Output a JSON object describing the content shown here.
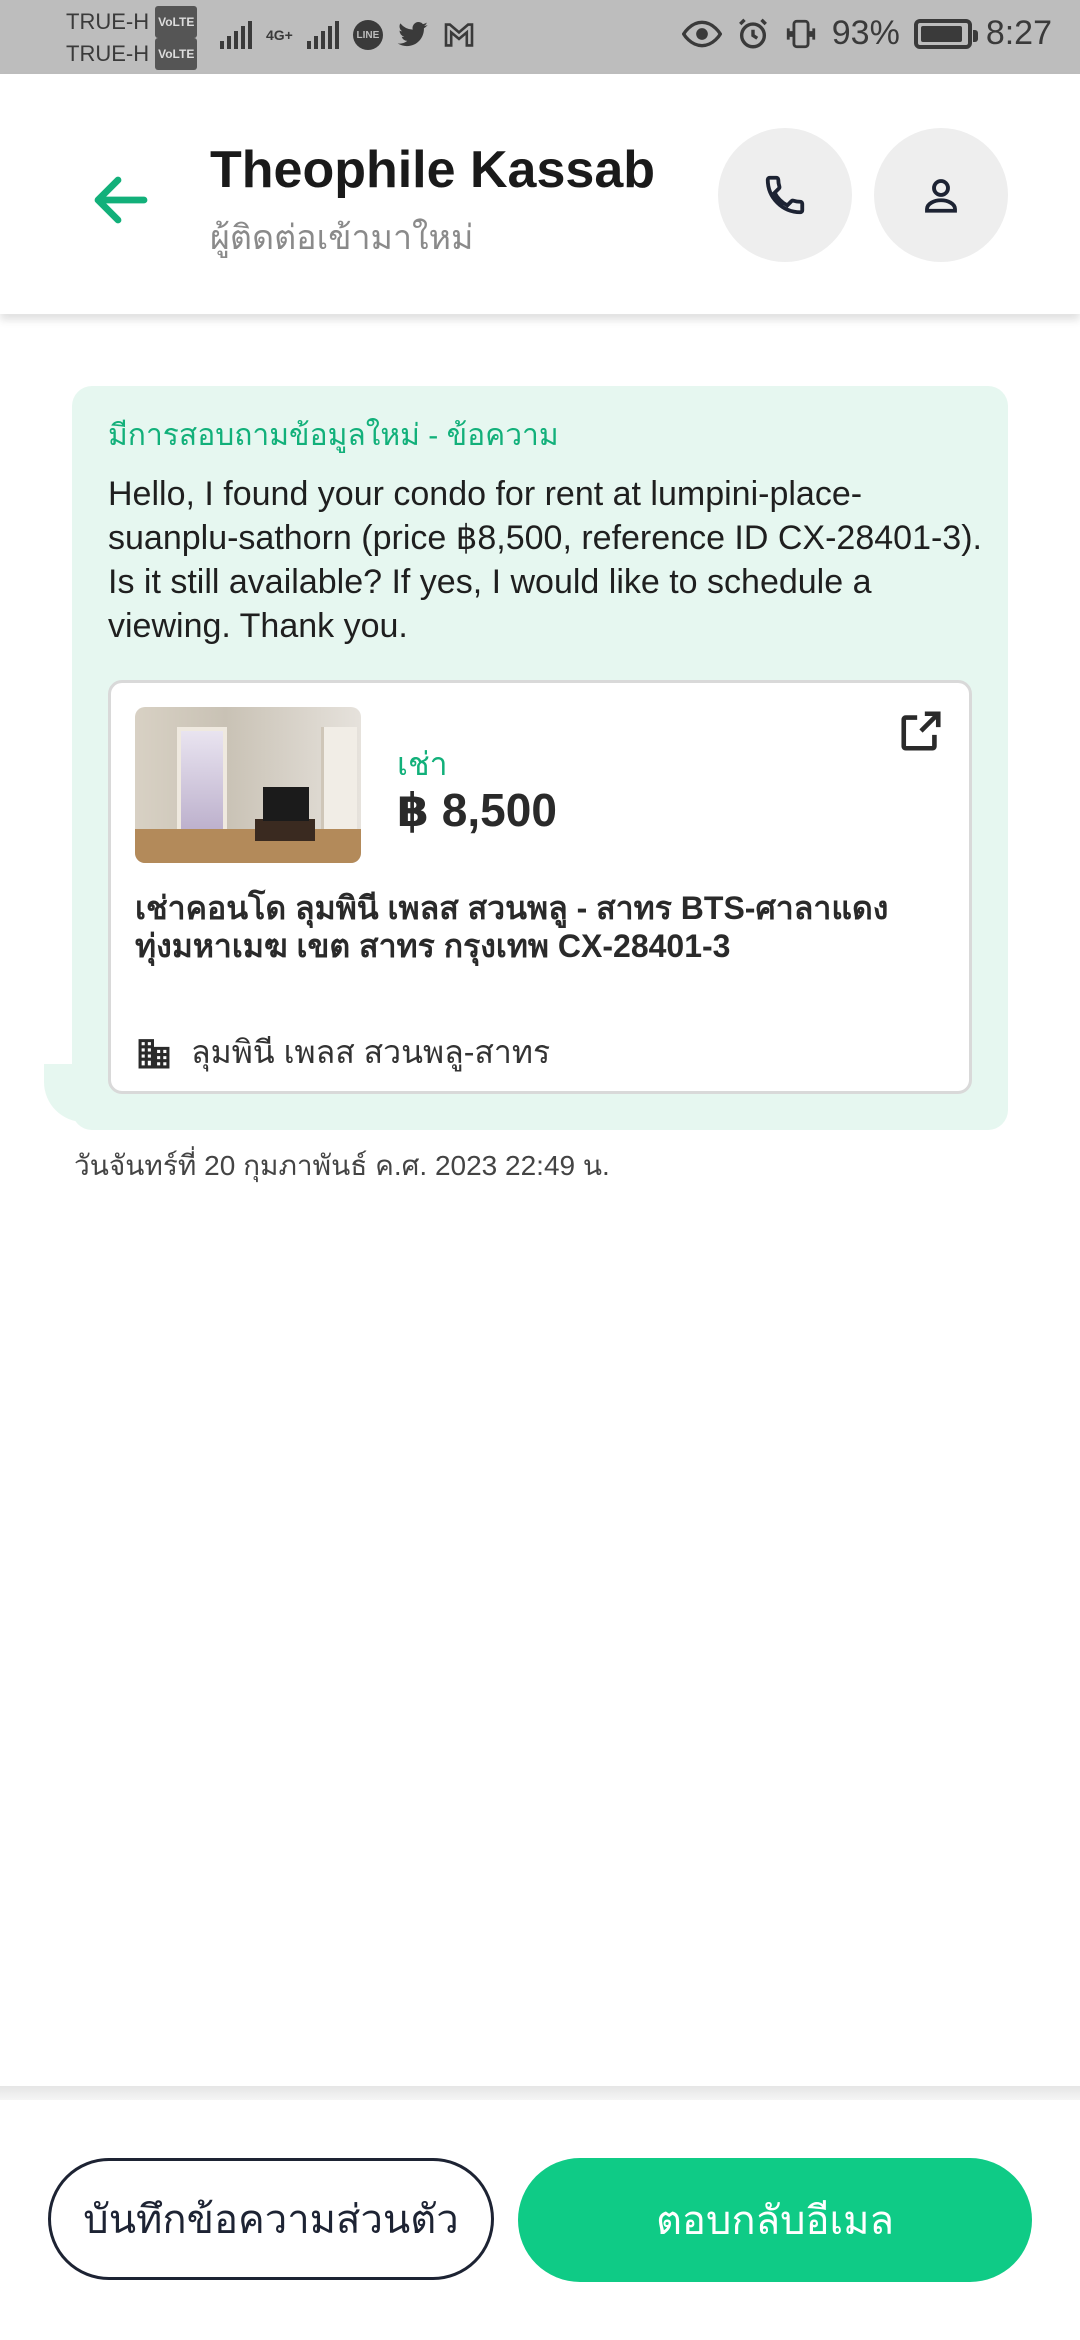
{
  "status_bar": {
    "carrier_1": "TRUE-H",
    "carrier_2": "TRUE-H",
    "volte": "VoLTE",
    "network": "4G+",
    "battery": "93%",
    "battery_level": 0.93,
    "time": "8:27",
    "icons": [
      "signal-icon",
      "line-app-icon",
      "twitter-icon",
      "gmail-icon",
      "eye-icon",
      "alarm-icon",
      "vibrate-icon",
      "battery-icon"
    ]
  },
  "header": {
    "contact_name": "Theophile Kassab",
    "contact_subtitle": "ผู้ติดต่อเข้ามาใหม่",
    "accent_color": "#12b07a"
  },
  "message": {
    "title": "มีการสอบถามข้อมูลใหม่ - ข้อความ",
    "body": "Hello, I found your condo for rent at lumpini-place-suanplu-sathorn (price ฿8,500, reference ID CX-28401-3). Is it still available? If yes, I would like to schedule a viewing. Thank you.",
    "listing": {
      "type_label": "เช่า",
      "price": "฿ 8,500",
      "title": "เช่าคอนโด  ลุมพินี เพลส สวนพลู - สาทร BTS-ศาลาแดง ทุ่งมหาเมฆ เขต สาทร กรุงเทพ CX-28401-3",
      "project": "ลุมพินี เพลส สวนพลู-สาทร"
    },
    "timestamp": "วันจันทร์ที่ 20 กุมภาพันธ์ ค.ศ. 2023 22:49 น."
  },
  "actions": {
    "note_label": "บันทึกข้อความส่วนตัว",
    "reply_label": "ตอบกลับอีเมล",
    "reply_color": "#0fcb86"
  }
}
